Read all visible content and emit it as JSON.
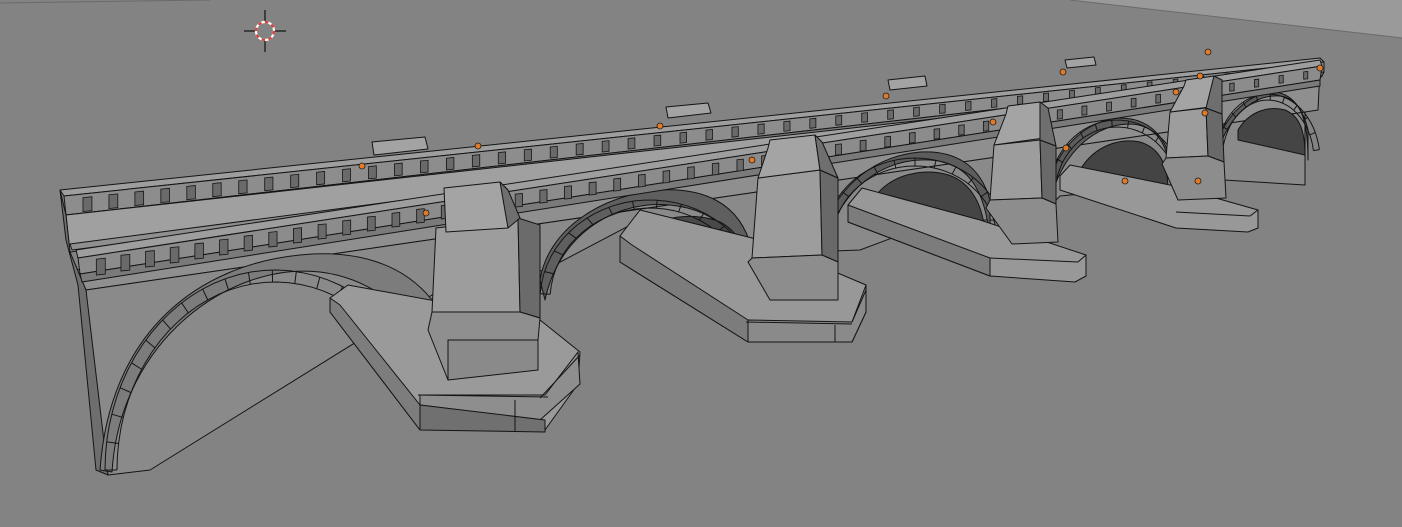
{
  "viewport": {
    "background": "#838383",
    "mode": "solid-wireframe"
  },
  "model": {
    "type": "stone arch bridge",
    "arches": 5,
    "piers": 4,
    "selected_object_origins": 15,
    "colors": {
      "face_light": "#9c9c9c",
      "face_mid": "#8b8b8b",
      "face_dark": "#5e5e5e",
      "face_shadow": "#474747",
      "wire": "#141414",
      "origin_dot": "#e07a28"
    }
  },
  "cursor_3d": {
    "icon": "3d-cursor-icon",
    "ring_colors": [
      "#ffffff",
      "#d8403a"
    ]
  }
}
